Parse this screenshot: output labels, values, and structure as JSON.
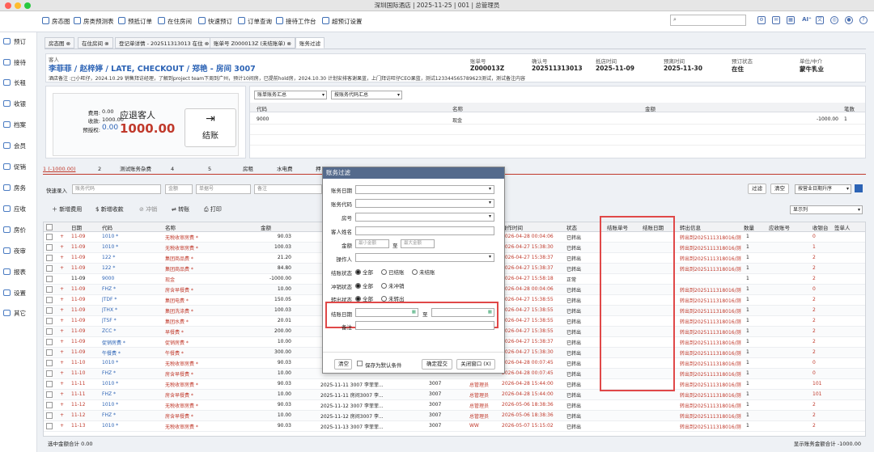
{
  "window": {
    "title": "深圳国际酒店 | 2025-11-25 | 001 | 总管理员"
  },
  "toolbar": {
    "items": [
      "房态图",
      "房类预测表",
      "预抵订单",
      "在住房间",
      "快速预订",
      "订单查询",
      "接待工作台",
      "超预订设置"
    ],
    "search_placeholder": "",
    "ai_label": "AI⁺"
  },
  "sidebar": {
    "items": [
      "预订",
      "接待",
      "长租",
      "收银",
      "档案",
      "会员",
      "促销",
      "房务",
      "应收",
      "房价",
      "夜审",
      "报表",
      "设置",
      "其它"
    ]
  },
  "tabs": [
    "房态图",
    "在住房间",
    "登记单详情 - 202511313013 在住",
    "账单号 Z000013Z (未结账单)",
    "账务过滤"
  ],
  "guest": {
    "label": "客人",
    "name": "李菲菲 / 赵梓婷 / LATE, CHECKOUT / 郑艳 - 房间 3007",
    "remark": "酒店备注 :□小旺仔，2024.10.29 销售拜访经理，了解到project team下周到广州，预计10间房，已提前hold房，2024.10.30 计划安排客谢果蓝，上门拜访旺仔CEO果蓝，测试123344565789623测试，测试备注内容",
    "fields": [
      {
        "label": "账单号",
        "value": "Z000013Z"
      },
      {
        "label": "确认号",
        "value": "202511313013"
      },
      {
        "label": "抵店时间",
        "value": "2025-11-09"
      },
      {
        "label": "预离时间",
        "value": "2025-11-30"
      },
      {
        "label": "预订状态",
        "value": "在住"
      },
      {
        "label": "单位/中介",
        "value": "蒙牛乳业"
      }
    ]
  },
  "summary": {
    "fee_label": "费用:",
    "fee": "0.00",
    "paid_label": "收款:",
    "paid": "1000.00",
    "auth_label": "预授权:",
    "auth": "0.00",
    "due_label": "应退客人",
    "due": "1000.00",
    "checkout_label": "结账"
  },
  "bills": {
    "selects": [
      "账单账务汇总",
      "按账务代码汇总"
    ],
    "headers": [
      "代码",
      "名称",
      "金额",
      "笔数"
    ],
    "rows": [
      {
        "code": "9000",
        "name": "现金",
        "amount": "-1000.00",
        "count": "1"
      }
    ]
  },
  "summary_row": {
    "items": [
      "1 (-1000.00)",
      "2",
      "测试账务杂费",
      "4",
      "5",
      "房租",
      "水电费",
      "押"
    ]
  },
  "quick_entry": {
    "label": "快速录入",
    "code_ph": "账务代码",
    "amount_ph": "金额",
    "doc_ph": "单据号",
    "remark_ph": "备注",
    "filter": "过滤",
    "clear": "清空",
    "sort": "按营业日期升序",
    "display": "显示列"
  },
  "actions": [
    "新增费用",
    "新增收款",
    "冲销",
    "转账",
    "打印"
  ],
  "grid": {
    "headers": [
      "日期",
      "代码",
      "名称",
      "金额",
      "",
      "",
      "",
      "",
      "",
      "",
      "操作时间",
      "状态",
      "结账单号",
      "结账日期",
      "转出信息",
      "数量",
      "应收账号",
      "收银台",
      "签单人"
    ],
    "rows": [
      {
        "date": "11-09",
        "code": "1010 *",
        "name": "无税收审房费 *",
        "amount": "90.03",
        "optime": "2026-04-28 00:04:06",
        "status": "已转出",
        "transfer": "转出到2025111318016/测",
        "qty": "1",
        "till": "0"
      },
      {
        "date": "11-09",
        "code": "1010 *",
        "name": "无税收审房费 *",
        "amount": "100.03",
        "optime": "2026-04-27 15:38:30",
        "status": "已转出",
        "transfer": "转出到2025111318016/测",
        "qty": "1",
        "till": "1"
      },
      {
        "date": "11-09",
        "code": "122 *",
        "name": "集团商品费 *",
        "amount": "21.20",
        "optime": "2026-04-27 15:38:37",
        "status": "已转出",
        "transfer": "转出到2025111318016/测",
        "qty": "1",
        "till": "2"
      },
      {
        "date": "11-09",
        "code": "122 *",
        "name": "集团商品费 *",
        "amount": "84.80",
        "optime": "2026-04-27 15:38:37",
        "status": "已转出",
        "transfer": "转出到2025111318016/测",
        "qty": "1",
        "till": "2"
      },
      {
        "date": "11-09",
        "code": "9000",
        "name": "现金",
        "amount": "-1000.00",
        "optime": "2026-04-27 15:58:18",
        "status": "正常",
        "transfer": "",
        "qty": "1",
        "till": "2"
      },
      {
        "date": "11-09",
        "code": "FHZ *",
        "name": "房含早餐费 *",
        "amount": "10.00",
        "optime": "2026-04-28 00:04:06",
        "status": "已转出",
        "transfer": "转出到2025111318016/测",
        "qty": "1",
        "till": "0"
      },
      {
        "date": "11-09",
        "code": "JTDF *",
        "name": "集团电费 *",
        "amount": "150.05",
        "optime": "2026-04-27 15:38:55",
        "status": "已转出",
        "transfer": "转出到2025111318016/测",
        "qty": "1",
        "till": "2"
      },
      {
        "date": "11-09",
        "code": "JTHX *",
        "name": "集团洗涤费 *",
        "amount": "100.03",
        "optime": "2026-04-27 15:38:55",
        "status": "已转出",
        "transfer": "转出到2025111318016/测",
        "qty": "1",
        "till": "2"
      },
      {
        "date": "11-09",
        "code": "JTSF *",
        "name": "集团水费 *",
        "amount": "20.01",
        "optime": "2026-04-27 15:38:55",
        "status": "已转出",
        "transfer": "转出到2025111318016/测",
        "qty": "1",
        "till": "2"
      },
      {
        "date": "11-09",
        "code": "ZCC *",
        "name": "早餐费 *",
        "amount": "200.00",
        "optime": "2026-04-27 15:38:55",
        "status": "已转出",
        "transfer": "转出到2025111318016/测",
        "qty": "1",
        "till": "2"
      },
      {
        "date": "11-09",
        "code": "促销房费 *",
        "name": "促销房费 *",
        "amount": "10.00",
        "optime": "2026-04-27 15:38:37",
        "status": "已转出",
        "transfer": "转出到2025111318016/测",
        "qty": "1",
        "till": "2"
      },
      {
        "date": "11-09",
        "code": "午餐费 *",
        "name": "午餐费 *",
        "amount": "300.00",
        "optime": "2026-04-27 15:38:30",
        "status": "已转出",
        "transfer": "转出到2025111318016/测",
        "qty": "1",
        "till": "2"
      },
      {
        "date": "11-10",
        "code": "1010 *",
        "name": "无税收审房费 *",
        "amount": "90.03",
        "optime": "2026-04-28 00:07:45",
        "status": "已转出",
        "transfer": "转出到2025111318016/测",
        "qty": "1",
        "till": "0"
      },
      {
        "date": "11-10",
        "code": "FHZ *",
        "name": "房含早餐费 *",
        "amount": "10.00",
        "optime": "2026-04-28 00:07:45",
        "status": "已转出",
        "transfer": "转出到2025111318016/测",
        "qty": "1",
        "till": "0"
      },
      {
        "date": "11-11",
        "code": "1010 *",
        "name": "无税收审房费 *",
        "amount": "90.03",
        "desc": "2025-11-11 3007 李菲菲...",
        "room": "3007",
        "op": "总管理员",
        "optime": "2026-04-28 15:44:00",
        "status": "已转出",
        "transfer": "转出到2025111318016/测",
        "qty": "1",
        "till": "101"
      },
      {
        "date": "11-11",
        "code": "FHZ *",
        "name": "房含早餐费 *",
        "amount": "10.00",
        "desc": "2025-11-11 房间3007 李...",
        "room": "3007",
        "op": "总管理员",
        "optime": "2026-04-28 15:44:00",
        "status": "已转出",
        "transfer": "转出到2025111318016/测",
        "qty": "1",
        "till": "101"
      },
      {
        "date": "11-12",
        "code": "1010 *",
        "name": "无税收审房费 *",
        "amount": "90.03",
        "desc": "2025-11-12 3007 李菲菲...",
        "room": "3007",
        "op": "总管理员",
        "optime": "2026-05-06 18:38:36",
        "status": "已转出",
        "transfer": "转出到2025111318016/测",
        "qty": "1",
        "till": "2"
      },
      {
        "date": "11-12",
        "code": "FHZ *",
        "name": "房含早餐费 *",
        "amount": "10.00",
        "desc": "2025-11-12 房间3007 李...",
        "room": "3007",
        "op": "总管理员",
        "optime": "2026-05-06 18:38:36",
        "status": "已转出",
        "transfer": "转出到2025111318016/测",
        "qty": "1",
        "till": "2"
      },
      {
        "date": "11-13",
        "code": "1010 *",
        "name": "无税收审房费 *",
        "amount": "90.03",
        "desc": "2025-11-13 3007 李菲菲...",
        "room": "3007",
        "op": "WW",
        "optime": "2026-05-07 15:15:02",
        "status": "已转出",
        "transfer": "转出到2025111318016/测",
        "qty": "1",
        "till": "2"
      }
    ]
  },
  "status": {
    "left": "选中金额合计 0.00",
    "right": "显示账务金额合计 -1000.00"
  },
  "dialog": {
    "title": "账务过滤",
    "labels": {
      "date": "账务日期",
      "code": "账务代码",
      "room": "房号",
      "guest": "客人姓名",
      "amount": "金额",
      "operator": "操作人",
      "settle": "结账状态",
      "reverse": "冲销状态",
      "transfer": "转出状态",
      "settle_date": "结账日期",
      "remark": "备注"
    },
    "min_amount": "最小金额",
    "to": "至",
    "max_amount": "最大金额",
    "settle_opts": [
      "全部",
      "已结账",
      "未结账"
    ],
    "reverse_opts": [
      "全部",
      "未冲销"
    ],
    "transfer_opts": [
      "全部",
      "未转出"
    ],
    "buttons": {
      "clear": "清空",
      "save_default": "保存为默认条件",
      "submit": "确定提交",
      "close": "关闭窗口 (X)"
    }
  },
  "colors": {
    "accent": "#2c63b5",
    "highlight": "#e04848",
    "title_blue": "#546a8c"
  }
}
